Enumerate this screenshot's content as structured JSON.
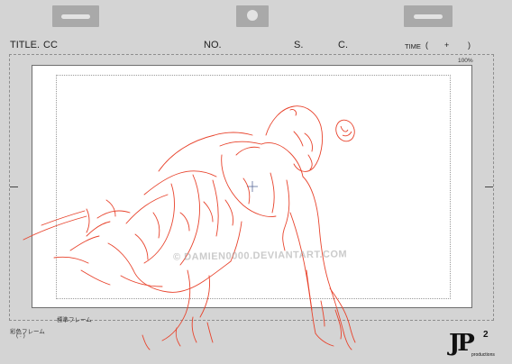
{
  "header": {
    "title_label": "TITLE.",
    "title_value": "CC",
    "no_label": "NO.",
    "s_label": "S.",
    "c_label": "C.",
    "time_label": "TIME",
    "time_open": "(",
    "time_plus": "+",
    "time_close": ")"
  },
  "frame": {
    "zoom": "100%",
    "standard_frame_label": "標準フレーム",
    "color_frame_label": "彩色フレーム",
    "color_frame_value": "(   :   )"
  },
  "watermark": "© DAMIEN0000.DEVIANTART.COM",
  "logo": {
    "mark": "JP",
    "superscript": "2",
    "subtext": "productions"
  },
  "colors": {
    "background": "#d4d4d4",
    "paper": "#ffffff",
    "sketch_line": "#e8432c",
    "punch_tab": "#a9a9a9"
  }
}
